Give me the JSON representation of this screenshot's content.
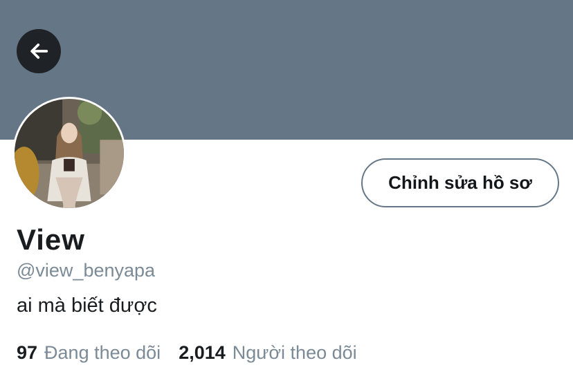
{
  "profile": {
    "display_name": "View",
    "handle": "@view_benyapa",
    "bio": "ai mà biết được",
    "edit_profile_label": "Chỉnh sửa hồ sơ"
  },
  "stats": {
    "following_count": "97",
    "following_label": "Đang theo dõi",
    "followers_count": "2,014",
    "followers_label": "Người theo dõi"
  },
  "icons": {
    "back": "arrow-left-icon"
  },
  "colors": {
    "banner": "#657786",
    "back_button_bg": "#1f2226",
    "secondary_text": "#7b8a97",
    "primary_text": "#14171a"
  }
}
